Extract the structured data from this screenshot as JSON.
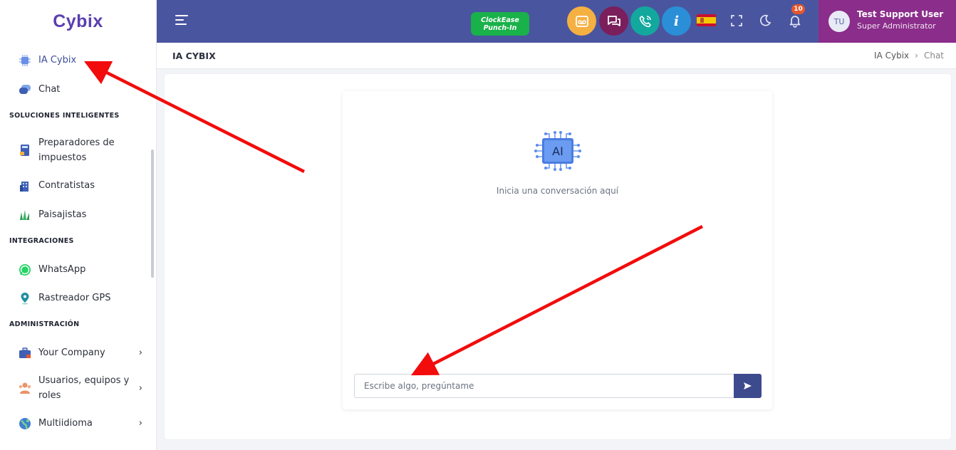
{
  "app": {
    "logo_text": "Cybix"
  },
  "sidebar": {
    "items_top": [
      {
        "label": "IA Cybix",
        "icon": "ai-chip-icon",
        "active": true
      },
      {
        "label": "Chat",
        "icon": "chat-bubbles-icon"
      }
    ],
    "section_smart": "SOLUCIONES INTELIGENTES",
    "items_smart": [
      {
        "label_line1": "Preparadores de",
        "label_line2": "impuestos",
        "icon": "calculator-icon"
      },
      {
        "label": "Contratistas",
        "icon": "building-icon"
      },
      {
        "label": "Paisajistas",
        "icon": "grass-icon"
      }
    ],
    "section_integrations": "INTEGRACIONES",
    "items_integrations": [
      {
        "label": "WhatsApp",
        "icon": "whatsapp-icon"
      },
      {
        "label": "Rastreador GPS",
        "icon": "map-pin-icon"
      }
    ],
    "section_admin": "ADMINISTRACIÓN",
    "items_admin": [
      {
        "label": "Your Company",
        "icon": "briefcase-icon",
        "chevron": "›"
      },
      {
        "label_line1": "Usuarios, equipos y",
        "label_line2": "roles",
        "icon": "users-icon",
        "chevron": "›"
      },
      {
        "label": "Multiidioma",
        "icon": "globe-icon",
        "chevron": "›"
      }
    ]
  },
  "topbar": {
    "clock_line1": "ClockEase",
    "clock_line2": "Punch-In",
    "quick_buttons": [
      {
        "icon": "voicemail-icon",
        "color": "#f5b042"
      },
      {
        "icon": "messages-icon",
        "color": "#7a1f5c"
      },
      {
        "icon": "phone-call-icon",
        "color": "#13a89e"
      },
      {
        "icon": "info-icon",
        "color": "#2a8fd6"
      }
    ],
    "language_flag": "spain-flag-icon",
    "notification_count": "10",
    "user": {
      "initials": "TU",
      "name": "Test Support User",
      "role": "Super Administrator"
    },
    "colors": {
      "bar": "#4a559f",
      "user_box": "#8b2d8b"
    }
  },
  "page": {
    "title": "IA CYBIX",
    "breadcrumb": [
      "IA Cybix",
      "Chat"
    ],
    "breadcrumb_sep": "›"
  },
  "chat": {
    "empty_text": "Inicia una conversación aquí",
    "ai_label": "AI",
    "input_placeholder": "Escribe algo, pregúntame",
    "input_value": ""
  }
}
